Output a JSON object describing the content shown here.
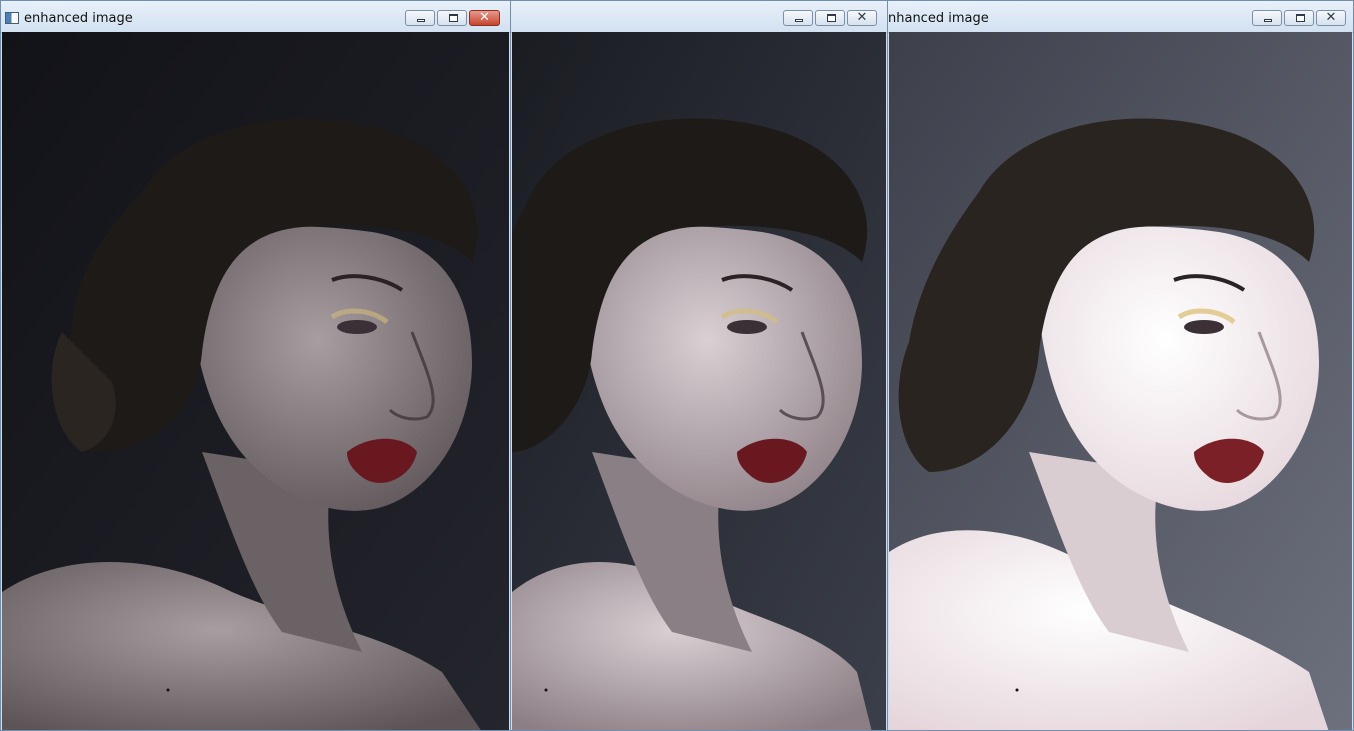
{
  "windows": [
    {
      "title": "enhanced image",
      "active": true,
      "controls": [
        "minimize-icon",
        "restore-icon",
        "close-icon"
      ]
    },
    {
      "title": "",
      "active": false,
      "controls": [
        "minimize-icon",
        "restore-icon",
        "close-icon"
      ]
    },
    {
      "title": "nhanced image",
      "active": false,
      "controls": [
        "minimize-icon",
        "restore-icon",
        "close-icon"
      ]
    }
  ],
  "colors": {
    "titlebar": "#d2e1f1",
    "close_active": "#c7442f",
    "window1_bg": "#1b1c22",
    "window2_bg": "#2b2e36",
    "window3_bg": "#5b5f6b",
    "lips": "#6a1820",
    "hair": "#1e1a18"
  },
  "icons": {
    "app": "window-app-icon",
    "minimize": "minimize-icon",
    "restore": "restore-icon",
    "close": "close-icon"
  }
}
